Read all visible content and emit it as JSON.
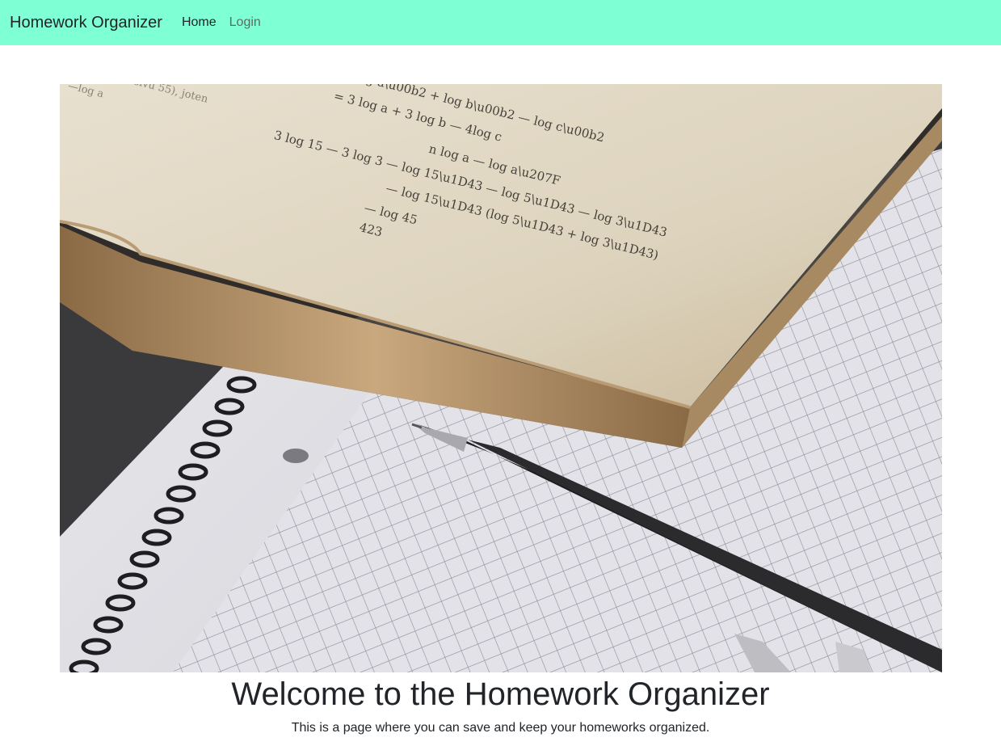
{
  "navbar": {
    "brand": "Homework Organizer",
    "links": [
      {
        "label": "Home"
      },
      {
        "label": "Login"
      }
    ],
    "background": "#7fffd4"
  },
  "hero_image": {
    "icon": "book-notebook-pen-photo",
    "text_on_page": [
      "n log a — log aⁿ",
      "— log 15ᵃ — log 5ᵃ — log 3ᵃ",
      "— log 15ᵃ / (log 5ᵃ + log 3ᵃ)",
      "— log 45",
      "423"
    ]
  },
  "main": {
    "title": "Welcome to the Homework Organizer",
    "subtitle": "This is a page where you can save and keep your homeworks organized."
  }
}
